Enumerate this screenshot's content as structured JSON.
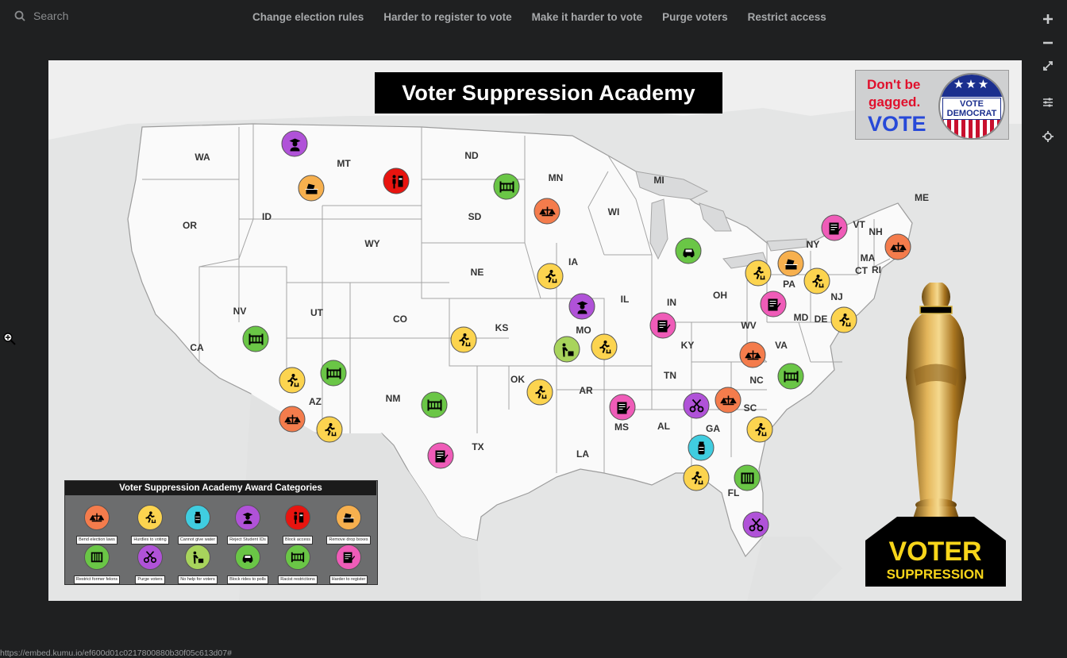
{
  "search": {
    "placeholder": "Search"
  },
  "nav": {
    "items": [
      "Change election rules",
      "Harder to register to vote",
      "Make it harder to vote",
      "Purge voters",
      "Restrict access"
    ]
  },
  "tools": {
    "icons": [
      "zoom-in-icon",
      "zoom-out-icon",
      "expand-icon",
      "settings-icon",
      "recenter-icon"
    ]
  },
  "map": {
    "title": "Voter Suppression Academy",
    "badge": {
      "line1": "Don't be",
      "line2": "gagged.",
      "line3": "VOTE",
      "seal_top": "★★★",
      "seal_text": "VOTE DEMOCRAT"
    },
    "states": [
      "WA",
      "MT",
      "ND",
      "MN",
      "OR",
      "ID",
      "SD",
      "WI",
      "MI",
      "VT",
      "NH",
      "ME",
      "WY",
      "NY",
      "MA",
      "CT",
      "RI",
      "IA",
      "NE",
      "PA",
      "NJ",
      "NV",
      "UT",
      "CO",
      "IL",
      "IN",
      "OH",
      "MD",
      "DE",
      "CA",
      "KS",
      "MO",
      "WV",
      "VA",
      "KY",
      "OK",
      "TN",
      "NC",
      "AZ",
      "NM",
      "AR",
      "SC",
      "MS",
      "AL",
      "GA",
      "TX",
      "LA",
      "FL"
    ],
    "legend": {
      "title": "Voter Suppression Academy Award Categories",
      "items": [
        {
          "label": "Bend election laws",
          "color": "#f47c4c",
          "icon": "scales-icon"
        },
        {
          "label": "Hurdles to voting",
          "color": "#fcd44f",
          "icon": "hurdle-runner-icon"
        },
        {
          "label": "Cannot give water",
          "color": "#40cde0",
          "icon": "water-bottle-icon"
        },
        {
          "label": "Reject Student IDs",
          "color": "#b052d8",
          "icon": "student-graduate-icon"
        },
        {
          "label": "Block access",
          "color": "#e8140f",
          "icon": "blocked-person-icon"
        },
        {
          "label": "Remove drop boxes",
          "color": "#f7b04e",
          "icon": "ballot-box-icon"
        },
        {
          "label": "Restrict former felons",
          "color": "#6ac646",
          "icon": "prison-bars-icon"
        },
        {
          "label": "Purge voters",
          "color": "#b052d8",
          "icon": "scissors-icon"
        },
        {
          "label": "No help for voters",
          "color": "#a8d45c",
          "icon": "helping-person-icon"
        },
        {
          "label": "Block rides to polls",
          "color": "#6ac646",
          "icon": "car-icon"
        },
        {
          "label": "Racist restrictions",
          "color": "#6ac646",
          "icon": "fence-icon"
        },
        {
          "label": "Harder to register",
          "color": "#ef5cb8",
          "icon": "registration-form-icon"
        }
      ]
    },
    "logo": {
      "line1": "VOTER",
      "line2": "SUPPRESSION"
    }
  },
  "status_url": "https://embed.kumu.io/ef600d01c0217800880b30f05c613d07#"
}
